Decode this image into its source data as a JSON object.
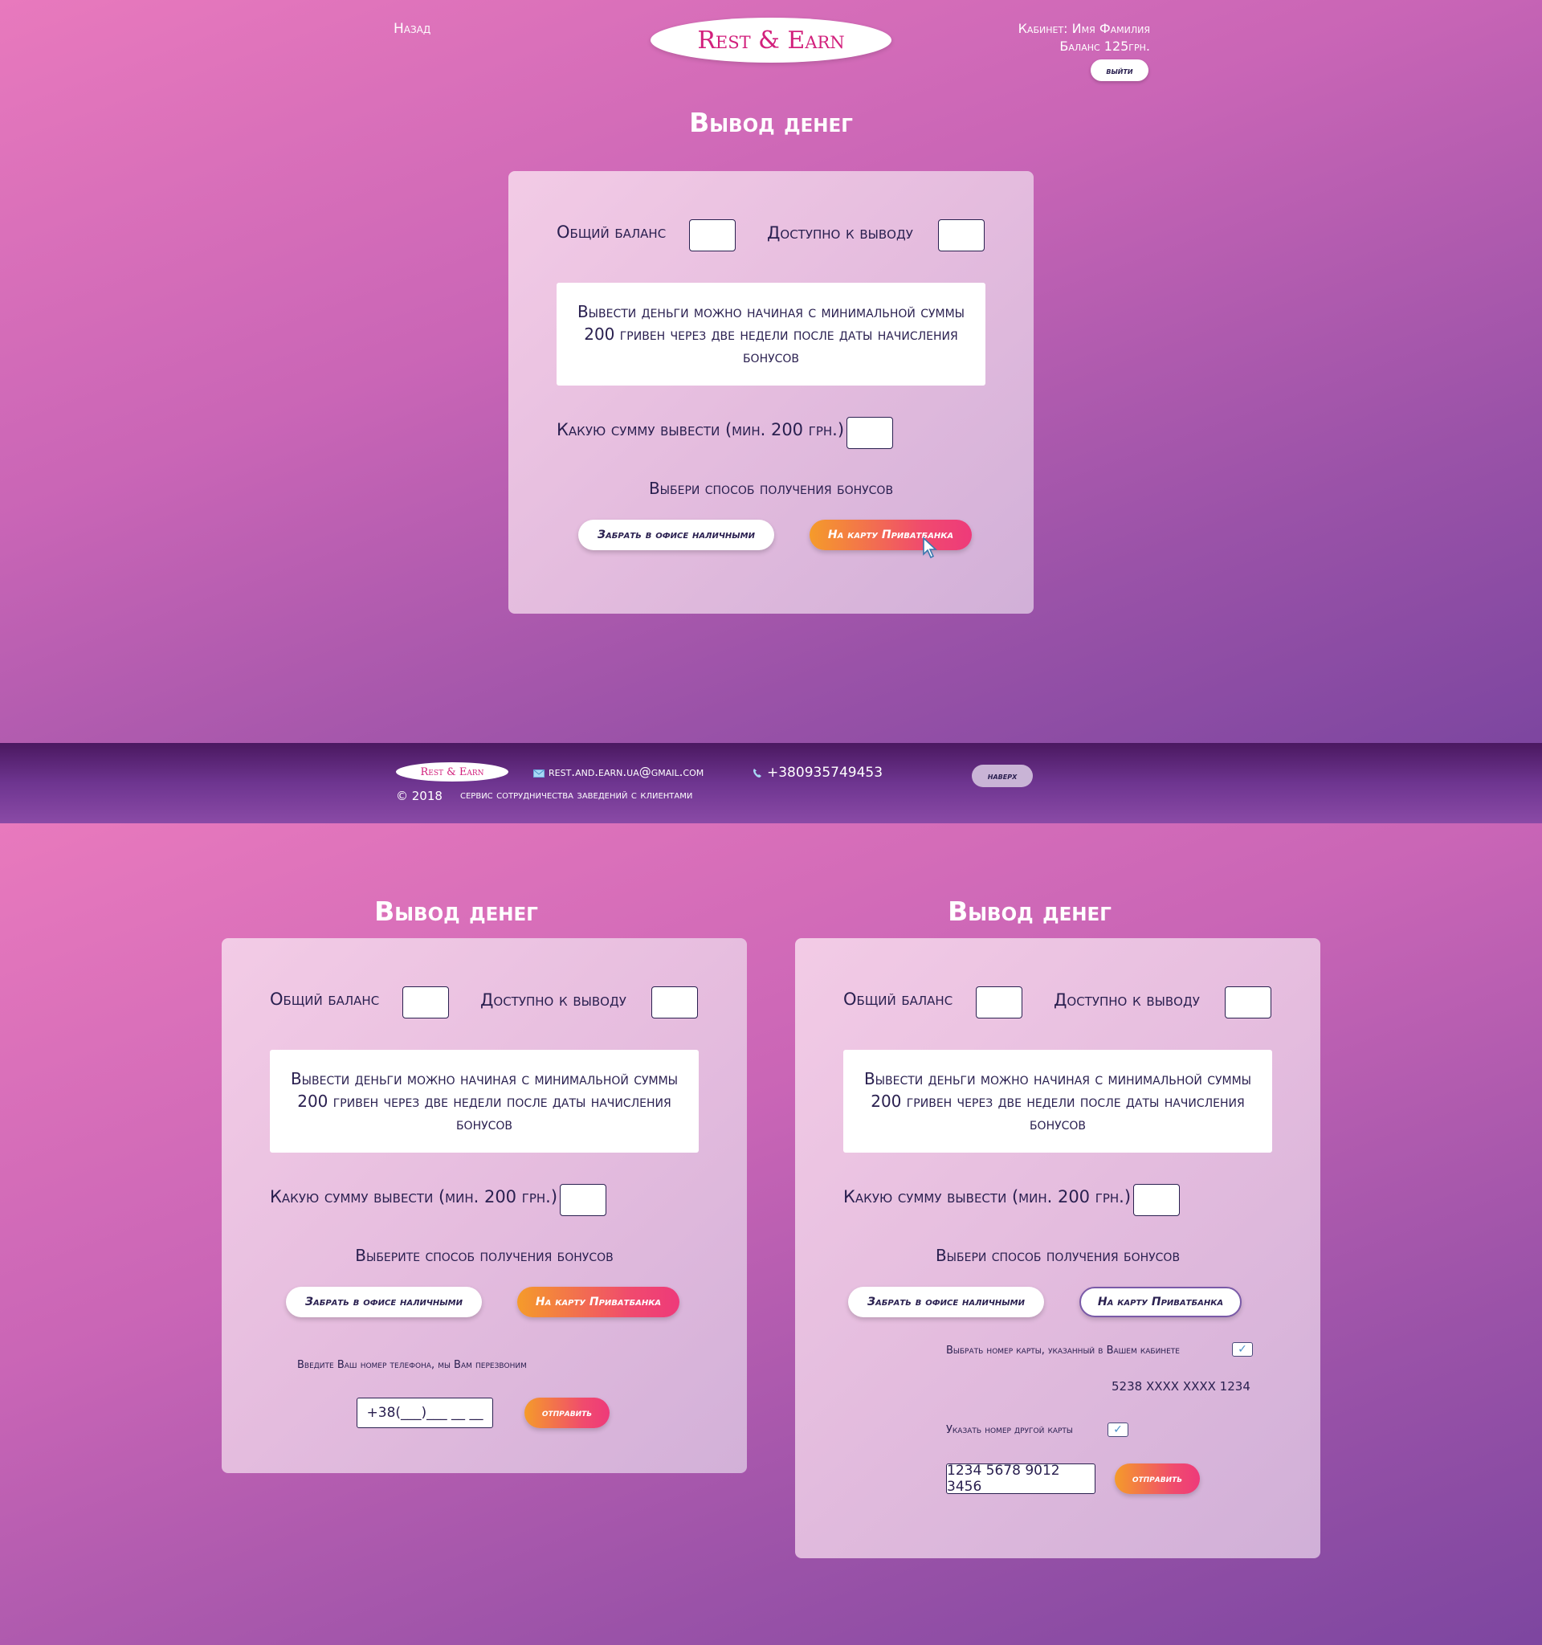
{
  "header": {
    "back": "Назад",
    "logo": "Rest & Earn",
    "cabinet": "Кабинет: Имя Фамилия",
    "balance": "Баланс 125грн.",
    "logout": "выйти"
  },
  "withdraw": {
    "title": "Вывод денег",
    "total_balance": "Общий баланс",
    "available": "Доступно к выводу",
    "note": "Вывести деньги можно начиная с минимальной суммы 200 гривен через две недели после даты начисления бонусов",
    "amount_label": "Какую сумму вывести (мин. 200 грн.)",
    "choose": "Выбери способ получения бонусов",
    "choose_alt": "Выберите способ получения бонусов",
    "btn_office": "Забрать в офисе наличными",
    "btn_card": "На карту Приватбанка"
  },
  "phone_form": {
    "hint": "Введите Ваш номер телефона, мы Вам перезвоним",
    "value": "+38(___)___ __ __",
    "submit": "отправить"
  },
  "card_form": {
    "choose_saved": "Выбрать номер карты, указанный в Вашем кабинете",
    "saved_card": "5238 XXXX XXXX 1234",
    "other_card": "Указать номер другой карты",
    "card_value": "1234 5678 9012 3456",
    "submit": "отправить"
  },
  "footer": {
    "logo": "Rest & Earn",
    "email": "rest.and.earn.ua@gmail.com",
    "phone": "+380935749453",
    "copyright": "© 2018",
    "tagline": "сервис сотрудничества заведений с клиентами",
    "to_top": "наверх"
  },
  "colors": {
    "accent_pink": "#d2207c",
    "gradient_orange": "#f59b2a",
    "gradient_pink": "#f04a6e",
    "text_dark": "#2a2050"
  }
}
